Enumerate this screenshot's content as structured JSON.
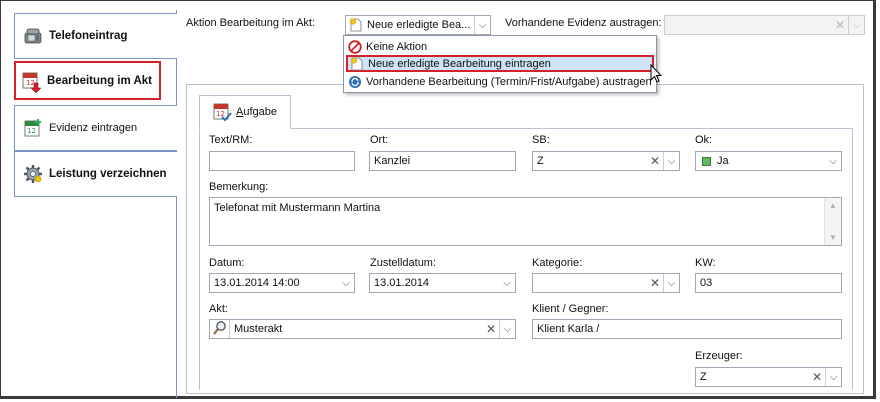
{
  "sidebar": {
    "items": [
      {
        "label": "Telefoneintrag",
        "icon": "phone-icon"
      },
      {
        "label": "Bearbeitung im Akt",
        "icon": "calendar-arrow-icon"
      },
      {
        "label": "Evidenz eintragen",
        "icon": "calendar-plus-icon"
      },
      {
        "label": "Leistung verzeichnen",
        "icon": "gear-icon"
      }
    ]
  },
  "toolbar": {
    "aktion_label": "Aktion Bearbeitung im Akt:",
    "aktion_value": "Neue erledigte Bea...",
    "evidenz_label": "Vorhandene Evidenz austragen:",
    "evidenz_value": ""
  },
  "dropdown": {
    "items": [
      {
        "label": "Keine Aktion",
        "icon": "no-entry-icon"
      },
      {
        "label": "Neue erledigte Bearbeitung eintragen",
        "icon": "new-document-icon"
      },
      {
        "label": "Vorhandene Bearbeitung (Termin/Frist/Aufgabe) austragen",
        "icon": "circular-arrows-icon"
      }
    ]
  },
  "tab": {
    "label": "Aufgabe",
    "underline_letter": "A",
    "rest": "ufgabe"
  },
  "form": {
    "text_rm": {
      "label": "Text/RM:",
      "value": ""
    },
    "ort": {
      "label": "Ort:",
      "value": "Kanzlei"
    },
    "sb": {
      "label": "SB:",
      "value": "Z"
    },
    "ok": {
      "label": "Ok:",
      "value": "Ja"
    },
    "bemerkung": {
      "label": "Bemerkung:",
      "value": "Telefonat mit Mustermann Martina"
    },
    "datum": {
      "label": "Datum:",
      "value": "13.01.2014 14:00"
    },
    "zustelldatum": {
      "label": "Zustelldatum:",
      "value": "13.01.2014"
    },
    "kategorie": {
      "label": "Kategorie:",
      "value": ""
    },
    "kw": {
      "label": "KW:",
      "value": "03"
    },
    "akt": {
      "label": "Akt:",
      "value": "Musterakt"
    },
    "klient": {
      "label": "Klient / Gegner:",
      "value": "Klient Karla /"
    },
    "erzeuger": {
      "label": "Erzeuger:",
      "value": "Z"
    }
  },
  "colors": {
    "highlight_red": "#d3212b",
    "border_blue": "#7a95c6",
    "selection_blue": "#cfe3f7"
  }
}
